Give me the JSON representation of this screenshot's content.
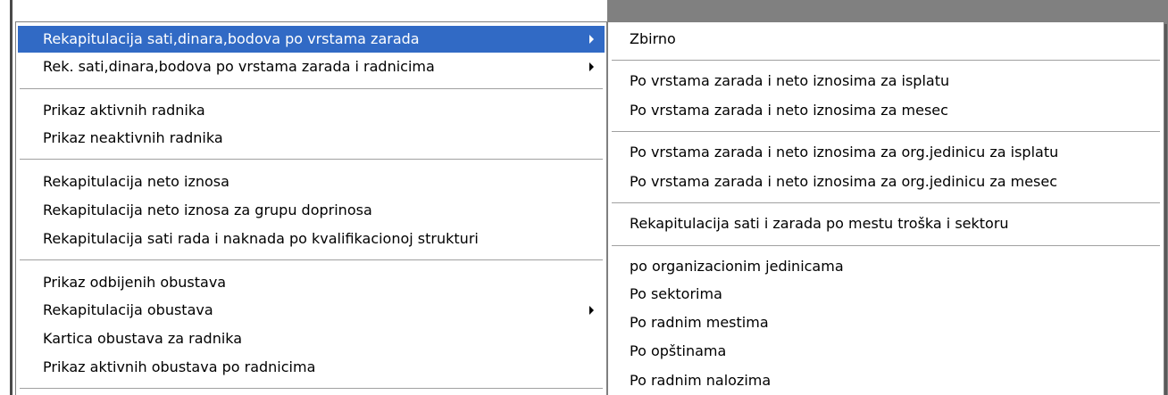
{
  "main_menu": {
    "items": [
      {
        "label": "Rekapitulacija sati,dinara,bodova po vrstama zarada",
        "icon": "chevron-right-icon"
      },
      {
        "label": "Rek. sati,dinara,bodova po vrstama zarada i radnicima",
        "icon": "chevron-right-icon"
      },
      {
        "label": "Prikaz aktivnih radnika"
      },
      {
        "label": "Prikaz neaktivnih radnika"
      },
      {
        "label": "Rekapitulacija neto iznosa"
      },
      {
        "label": "Rekapitulacija neto iznosa za grupu doprinosa"
      },
      {
        "label": "Rekapitulacija sati rada i naknada po kvalifikacionoj strukturi"
      },
      {
        "label": "Prikaz odbijenih obustava"
      },
      {
        "label": "Rekapitulacija obustava",
        "icon": "chevron-right-icon"
      },
      {
        "label": "Kartica obustava za radnika"
      },
      {
        "label": "Prikaz aktivnih obustava po radnicima"
      }
    ]
  },
  "sub_menu": {
    "items": [
      {
        "label": "Zbirno"
      },
      {
        "label": "Po vrstama zarada i neto iznosima za isplatu"
      },
      {
        "label": "Po vrstama zarada i neto iznosima za mesec"
      },
      {
        "label": "Po vrstama zarada i neto iznosima za org.jedinicu za isplatu"
      },
      {
        "label": "Po vrstama zarada i neto iznosima za org.jedinicu za mesec"
      },
      {
        "label": "Rekapitulacija sati i zarada po mestu troška i sektoru"
      },
      {
        "label": "po organizacionim jedinicama"
      },
      {
        "label": "Po sektorima"
      },
      {
        "label": "Po radnim mestima"
      },
      {
        "label": "Po opštinama"
      },
      {
        "label": "Po radnim nalozima"
      }
    ]
  },
  "colors": {
    "selection": "#316ac5",
    "background": "#808080"
  }
}
